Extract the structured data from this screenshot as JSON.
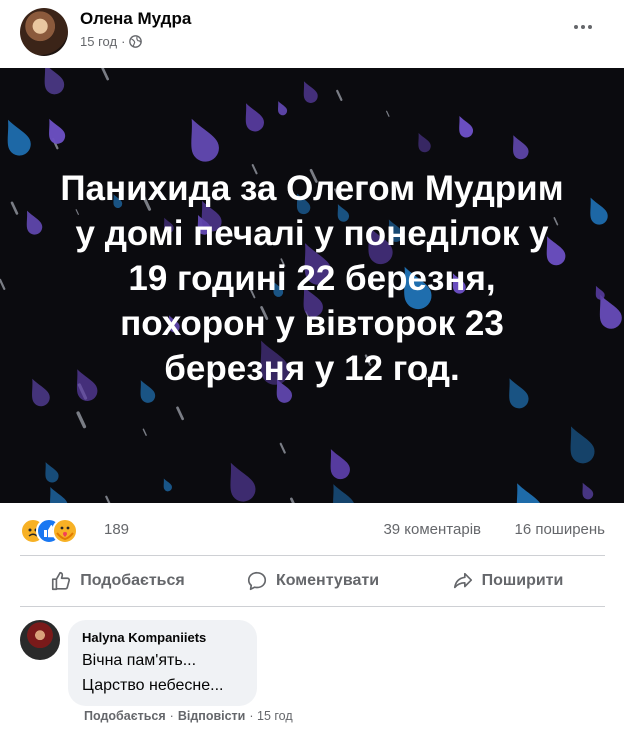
{
  "post": {
    "author": "Олена Мудра",
    "time": "15 год",
    "separator": "·",
    "audience_icon": "globe-icon",
    "more_icon": "more-horizontal-icon"
  },
  "image": {
    "background": "#0b0b0f",
    "drop_colors": [
      "#5b3ea6",
      "#1f6fb0",
      "#6b4fc2"
    ],
    "lines": [
      "Панихида за Олегом Мудрим",
      "у домі печалі у понеділок у",
      "19 годині 22 березня,",
      "похорон у вівторок 23",
      "березня у 12 год."
    ]
  },
  "stats": {
    "reactions": [
      "sad-reaction-icon",
      "like-reaction-icon",
      "care-reaction-icon"
    ],
    "reaction_count": "189",
    "comments": "39 коментарів",
    "shares": "16 поширень"
  },
  "actions": {
    "like": "Подобається",
    "comment": "Коментувати",
    "share": "Поширити"
  },
  "comment": {
    "name": "Halyna Kompaniiets",
    "line1": "Вічна пам'ять...",
    "line2": "Царство небесне...",
    "like": "Подобається",
    "dot": "·",
    "reply": "Відповісти",
    "time": "· 15 год"
  },
  "colors": {
    "secondary_text": "#65676b",
    "divider": "#ced0d4",
    "comment_bubble": "#f0f2f5",
    "facebook_blue": "#1877f2"
  }
}
